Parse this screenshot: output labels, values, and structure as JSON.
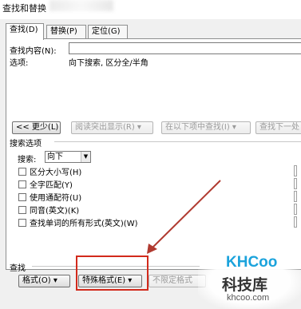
{
  "window": {
    "title": "查找和替换"
  },
  "tabs": [
    {
      "label": "查找(D)",
      "active": true
    },
    {
      "label": "替换(P)",
      "active": false
    },
    {
      "label": "定位(G)",
      "active": false
    }
  ],
  "find": {
    "label": "查找内容(N):",
    "value": "",
    "options_label": "选项:",
    "options_value": "向下搜索, 区分全/半角"
  },
  "buttons": {
    "less": "<< 更少(L)",
    "reading_highlight": "阅读突出显示(R) ▾",
    "find_in": "在以下项中查找(I) ▾",
    "find_next": "查找下一处"
  },
  "search_options": {
    "heading": "搜索选项",
    "search_label": "搜索:",
    "search_value": "向下",
    "checkboxes": [
      {
        "label": "区分大小写(H)",
        "checked": false
      },
      {
        "label": "全字匹配(Y)",
        "checked": false
      },
      {
        "label": "使用通配符(U)",
        "checked": false
      },
      {
        "label": "同音(英文)(K)",
        "checked": false
      },
      {
        "label": "查找单词的所有形式(英文)(W)",
        "checked": false
      }
    ]
  },
  "find_section": {
    "heading": "查找",
    "format_button": "格式(O) ▾",
    "special_button": "特殊格式(E) ▾",
    "no_format_button": "不限定格式"
  },
  "annotation": {
    "box_color": "#d22a1c",
    "arrow_color": "#b03a30"
  },
  "watermark": {
    "logo": "KHCoo",
    "name": "科技库",
    "url": "khcoo.com"
  }
}
